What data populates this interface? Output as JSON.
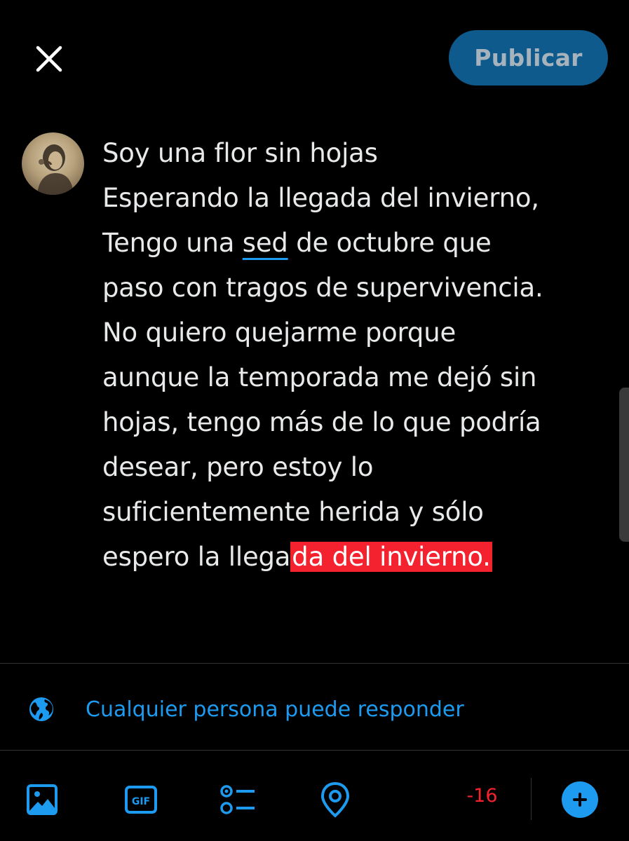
{
  "header": {
    "close_icon": "close-icon",
    "publish_label": "Publicar"
  },
  "avatar": {
    "icon": "avatar-photo"
  },
  "compose": {
    "lines": [
      "Soy una flor sin hojas",
      "Esperando la llegada del invierno,",
      "Tengo una ",
      "sed",
      " de octubre que",
      "paso con tragos de supervivencia.",
      "No quiero quejarme porque",
      "aunque la temporada me dejó sin",
      "hojas, tengo más de lo que podría",
      "desear, pero estoy lo",
      "suficientemente herida y sólo",
      "espero la llega",
      "da del invierno."
    ]
  },
  "reply_settings": {
    "icon": "globe-icon",
    "label": "Cualquier persona puede responder"
  },
  "toolbar": {
    "icons": [
      "image-icon",
      "gif-icon",
      "poll-icon",
      "location-icon"
    ],
    "char_remaining": "-16",
    "add_icon": "add-thread-icon"
  },
  "colors": {
    "accent": "#1d9bf0",
    "error": "#f4212e",
    "publish_bg": "#0f5a8c",
    "background": "#000000",
    "text": "#e7e9ea"
  }
}
